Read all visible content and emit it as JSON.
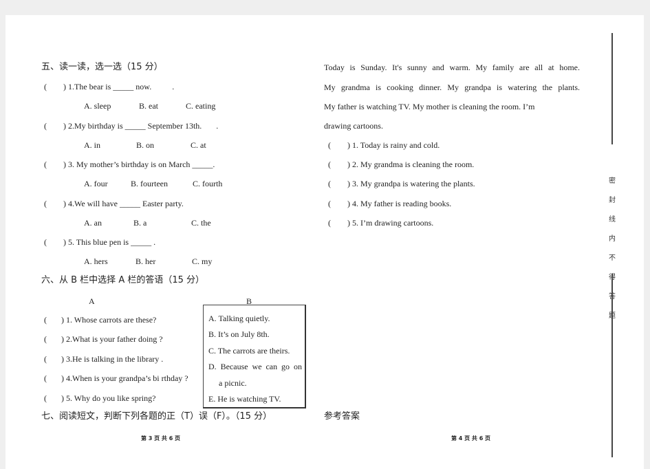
{
  "section5": {
    "title": "五、读一读，选一选（15 分）",
    "questions": [
      {
        "q": "(        ) 1.The bear is _____ now.          .",
        "a": "A. sleep",
        "b": "B. eat",
        "c": "C. eating"
      },
      {
        "q": "(        ) 2.My birthday is _____ September 13th.       .",
        "a": "A. in",
        "b": "B. on",
        "c": "C. at"
      },
      {
        "q": "(        ) 3. My mother’s birthday is on March _____.",
        "a": "A. four",
        "b": "B. fourteen",
        "c": "C. fourth"
      },
      {
        "q": "(        ) 4.We will have _____ Easter party.",
        "a": "A. an",
        "b": "B. a",
        "c": "C. the"
      },
      {
        "q": "(        ) 5. This blue pen is _____ .",
        "a": "A. hers",
        "b": "B. her",
        "c": "C. my"
      }
    ]
  },
  "section6": {
    "title": "六、从 B 栏中选择 A 栏的答语（15 分）",
    "col_a_label": "A",
    "col_b_label": "B",
    "a_items": [
      "(       ) 1. Whose carrots are these?",
      "(       ) 2.What is your father doing ?",
      "(       ) 3.He is talking in the library .",
      "(       ) 4.When is your grandpa’s bi rthday ?",
      "(       ) 5. Why do you like spring?"
    ],
    "b_items": [
      "A. Talking quietly.",
      "B. It’s on July 8th.",
      "C. The carrots are theirs.",
      "D. Because we can go on",
      "a picnic.",
      "E. He is watching TV."
    ]
  },
  "section7": {
    "title": "七、阅读短文，判断下列各题的正（T）误（F）。（15 分）"
  },
  "reading": {
    "passage": [
      "Today is Sunday. It's sunny and warm. My family are all at home.",
      "My grandma is cooking dinner. My grandpa is watering the plants.",
      "My father is watching TV. My mother is cleaning the room. I’m",
      "drawing cartoons."
    ],
    "statements": [
      "(        ) 1. Today is rainy and cold.",
      "(        ) 2. My grandma is cleaning the room.",
      "(        ) 3. My grandpa is watering the plants.",
      "(        ) 4. My father is reading books.",
      "(        ) 5. I’m drawing cartoons."
    ]
  },
  "answers_title": "参考答案",
  "footer": {
    "left": "第 3 页 共 6 页",
    "right": "第 4 页 共 6 页"
  },
  "binding_text": [
    "密",
    "封",
    "线",
    "内",
    "不",
    "得",
    "答",
    "题"
  ]
}
